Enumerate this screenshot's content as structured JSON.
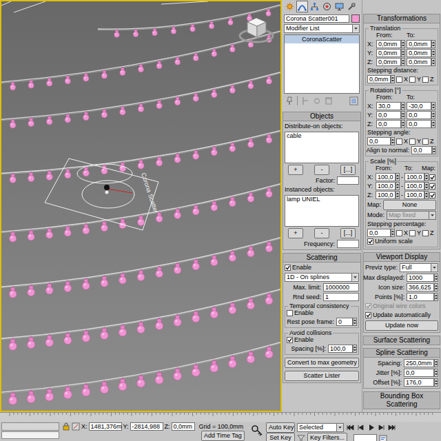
{
  "viewport": {
    "scatter_icon_label": "Corona Scatter"
  },
  "command_panel_tabs": [
    {
      "selected": false
    },
    {
      "selected": true
    },
    {
      "selected": false
    },
    {
      "selected": false
    },
    {
      "selected": false
    },
    {
      "selected": false
    }
  ],
  "object": {
    "name": "Corona Scatter001",
    "color": "#f49ad2"
  },
  "modifier_list": "Modifier List",
  "modifier_stack": [
    {
      "label": "CoronaScatter",
      "selected": true
    }
  ],
  "objects": {
    "title": "Objects",
    "expanded": true,
    "distribute_label": "Distribute-on objects:",
    "distribute_items": [
      "cable"
    ],
    "distribute_buttons": [
      "+",
      "-",
      "[...]"
    ],
    "factor_label": "Factor:",
    "instanced_label": "Instanced objects:",
    "instanced_items": [
      "lamp UNIEL"
    ],
    "instanced_buttons": [
      "+",
      "-",
      "[...]"
    ],
    "frequency_label": "Frequency:"
  },
  "scattering": {
    "title": "Scattering",
    "expanded": true,
    "enable": {
      "label": "Enable",
      "checked": true
    },
    "mode": "1D - On splines",
    "max_limit": {
      "label": "Max. limit:",
      "value": "1000000"
    },
    "rnd_seed": {
      "label": "Rnd seed:",
      "value": "1"
    },
    "temporal": {
      "title": "Temporal consistency",
      "enable": {
        "label": "Enable",
        "checked": false
      },
      "rest_pose": {
        "label": "Rest pose frame:",
        "value": "0"
      }
    },
    "avoid": {
      "title": "Avoid collisions",
      "enable": {
        "label": "Enable",
        "checked": true
      },
      "spacing": {
        "label": "Spacing [%]:",
        "value": "100,0"
      }
    },
    "buttons": [
      "Convert to max geometry",
      "Scatter Lister"
    ]
  },
  "transformations": {
    "title": "Transformations",
    "expanded": true,
    "translation": {
      "title": "Translation",
      "from": "From:",
      "to": "To:",
      "rows": [
        {
          "axis": "X:",
          "from": "0,0mm",
          "to": "0,0mm"
        },
        {
          "axis": "Y:",
          "from": "0,0mm",
          "to": "0,0mm"
        },
        {
          "axis": "Z:",
          "from": "0,0mm",
          "to": "0,0mm"
        }
      ],
      "stepping": {
        "label": "Stepping distance:",
        "value": "0,0mm",
        "axes": [
          {
            "label": "X",
            "checked": false
          },
          {
            "label": "Y",
            "checked": false
          },
          {
            "label": "Z",
            "checked": false
          }
        ]
      }
    },
    "rotation": {
      "title": "Rotation [°]",
      "from": "From:",
      "to": "To:",
      "rows": [
        {
          "axis": "X:",
          "from": "30,0",
          "to": "-30,0"
        },
        {
          "axis": "Y:",
          "from": "0,0",
          "to": "0,0"
        },
        {
          "axis": "Z:",
          "from": "0,0",
          "to": "0,0"
        }
      ],
      "stepping": {
        "label": "Stepping angle:",
        "value": "0,0",
        "axes": [
          {
            "label": "X",
            "checked": false
          },
          {
            "label": "Y",
            "checked": false
          },
          {
            "label": "Z",
            "checked": false
          }
        ]
      },
      "align": {
        "label": "Align to normal:",
        "value": "0,0"
      }
    },
    "scale": {
      "title": "Scale [%]",
      "from": "From:",
      "to": "To:",
      "map_header": "Map:",
      "rows": [
        {
          "axis": "X:",
          "from": "100,0",
          "separator": "-",
          "to": "100,0",
          "map": true
        },
        {
          "axis": "Y:",
          "from": "100,0",
          "separator": "-",
          "to": "100,0",
          "map": true
        },
        {
          "axis": "Z:",
          "from": "100,0",
          "separator": "-",
          "to": "100,0",
          "map": true
        }
      ],
      "map": {
        "label": "Map:",
        "value": "None"
      },
      "mode": {
        "label": "Mode:",
        "value": "Map fixed",
        "disabled": true
      },
      "stepping": {
        "label": "Stepping percentage:",
        "value": "0,0",
        "axes": [
          {
            "label": "X",
            "checked": false
          },
          {
            "label": "Y",
            "checked": false
          },
          {
            "label": "Z",
            "checked": false
          }
        ]
      },
      "uniform": {
        "label": "Uniform scale",
        "checked": true
      }
    }
  },
  "viewport_display": {
    "title": "Viewport Display",
    "expanded": true,
    "previz": {
      "label": "Previz type:",
      "value": "Full"
    },
    "max_displayed": {
      "label": "Max displayed:",
      "value": "1000"
    },
    "icon_size": {
      "label": "Icon size:",
      "value": "366,625"
    },
    "points": {
      "label": "Points [%]:",
      "value": "1,0"
    },
    "original_wire": {
      "label": "Original wire colors",
      "checked": true,
      "disabled": true
    },
    "update_auto": {
      "label": "Update automatically",
      "checked": true
    },
    "update_button": "Update now"
  },
  "surface_scattering": {
    "title": "Surface Scattering",
    "expanded": false
  },
  "spline_scattering": {
    "title": "Spline Scattering",
    "expanded": true,
    "spacing": {
      "label": "Spacing:",
      "value": "250,0mm"
    },
    "jitter": {
      "label": "Jitter [%]:",
      "value": "0,0"
    },
    "offset": {
      "label": "Offset [%]:",
      "value": "176,0"
    }
  },
  "bbox_scattering": {
    "title": "Bounding Box Scattering",
    "expanded": false
  },
  "status_bar": {
    "x": {
      "label": "X:",
      "value": "1481,376m"
    },
    "y": {
      "label": "Y:",
      "value": "-2814,988"
    },
    "z": {
      "label": "Z:",
      "value": "0,0mm"
    },
    "grid": "Grid = 100,0mm",
    "add_time_tag": "Add Time Tag",
    "auto_key": "Auto Key",
    "key_mode": "Selected",
    "set_key": "Set Key",
    "key_filters": "Key Filters..."
  }
}
